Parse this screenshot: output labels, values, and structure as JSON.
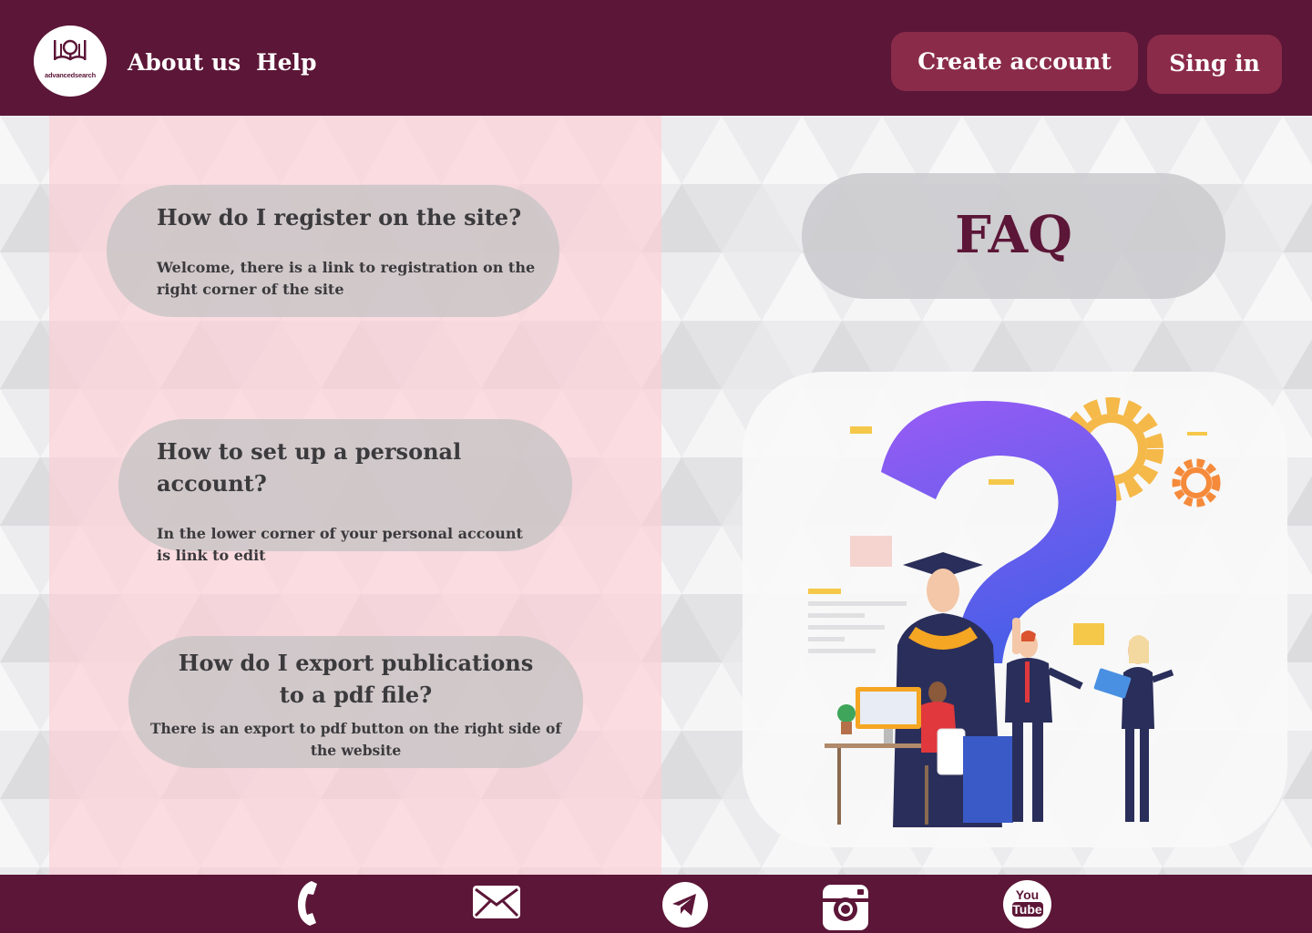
{
  "header": {
    "logo_text": "advancedsearch",
    "nav": {
      "about": "About us",
      "help": "Help"
    },
    "buttons": {
      "create_account": "Create account",
      "sign_in": "Sing in"
    }
  },
  "faq": {
    "title": "FAQ",
    "items": [
      {
        "question": "How do I register on the site?",
        "answer": "Welcome, there is a link to registration on the right corner of the site"
      },
      {
        "question": "How to set up a personal account?",
        "answer": "In the lower corner of your personal account is link to edit"
      },
      {
        "question": "How do I export publications to  a pdf file?",
        "answer": "There is an export to pdf button on the right side of the website"
      }
    ]
  },
  "illustration": {
    "icon": "graduates-question-mark-illustration"
  },
  "footer": {
    "icons": [
      "phone-icon",
      "mail-icon",
      "telegram-icon",
      "instagram-icon",
      "youtube-icon"
    ],
    "youtube_text": {
      "line1": "You",
      "line2": "Tube"
    }
  },
  "colors": {
    "brand": "#5c1637",
    "button": "#8a2b4a",
    "pink_panel": "#fdcdd3",
    "card_gray": "#c8c4c6",
    "text_dark": "#3b3a3d",
    "question_mark_top": "#9a5cf5",
    "question_mark_bottom": "#4a5ee8",
    "gear": "#f5b94a"
  }
}
